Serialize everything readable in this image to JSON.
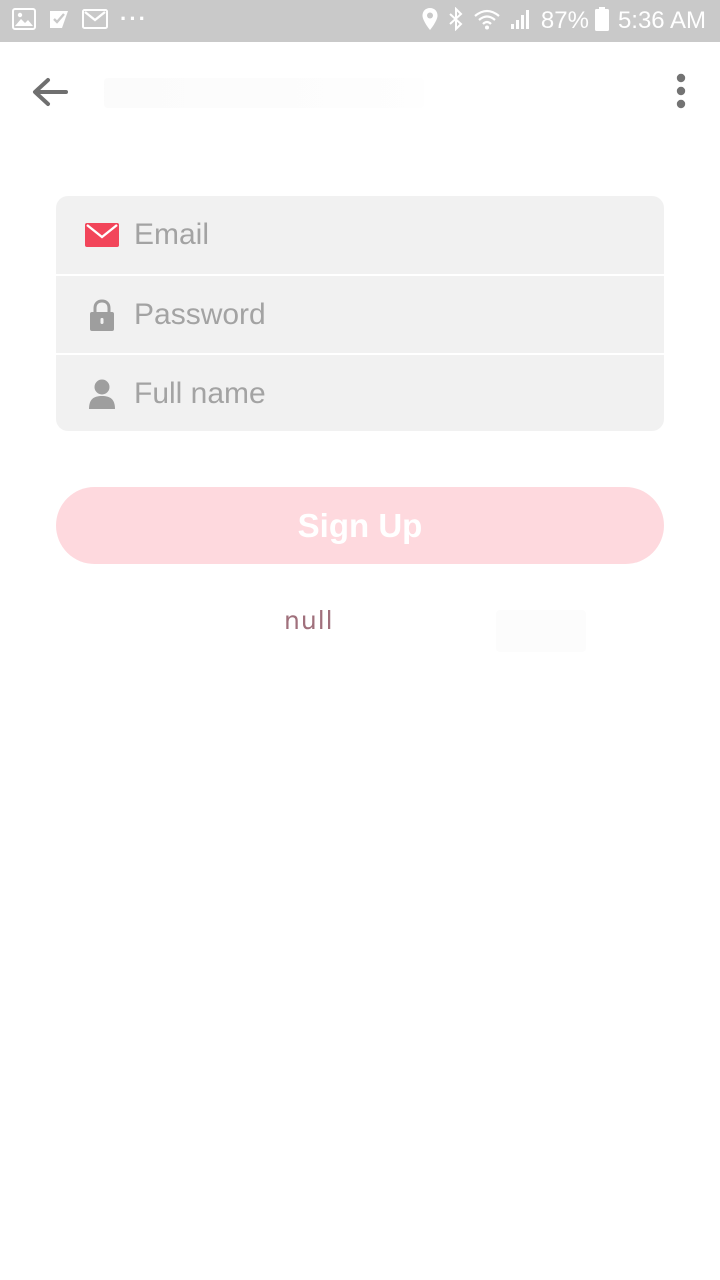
{
  "status_bar": {
    "battery": "87%",
    "time": "5:36 AM",
    "notification_icons": [
      "gallery-icon",
      "check-icon",
      "gmail-icon",
      "more-dots-icon"
    ],
    "system_icons": [
      "location-icon",
      "bluetooth-icon",
      "wifi-icon",
      "signal-icon",
      "battery-icon"
    ]
  },
  "app_bar": {
    "back_icon": "arrow-left-icon",
    "overflow_icon": "more-vertical-icon"
  },
  "form": {
    "email": {
      "placeholder": "Email",
      "value": "",
      "icon": "mail-icon"
    },
    "password": {
      "placeholder": "Password",
      "value": "",
      "icon": "lock-icon"
    },
    "full_name": {
      "placeholder": "Full name",
      "value": "",
      "icon": "person-icon"
    }
  },
  "signup_label": "Sign Up",
  "footer_text": "null",
  "colors": {
    "status_bar": "#c9c9c9",
    "field_bg": "#f1f1f1",
    "accent": "#f2455a",
    "button_bg": "#fed9de",
    "icon_grey": "#9e9e9e",
    "footer_text": "#a0707c"
  }
}
